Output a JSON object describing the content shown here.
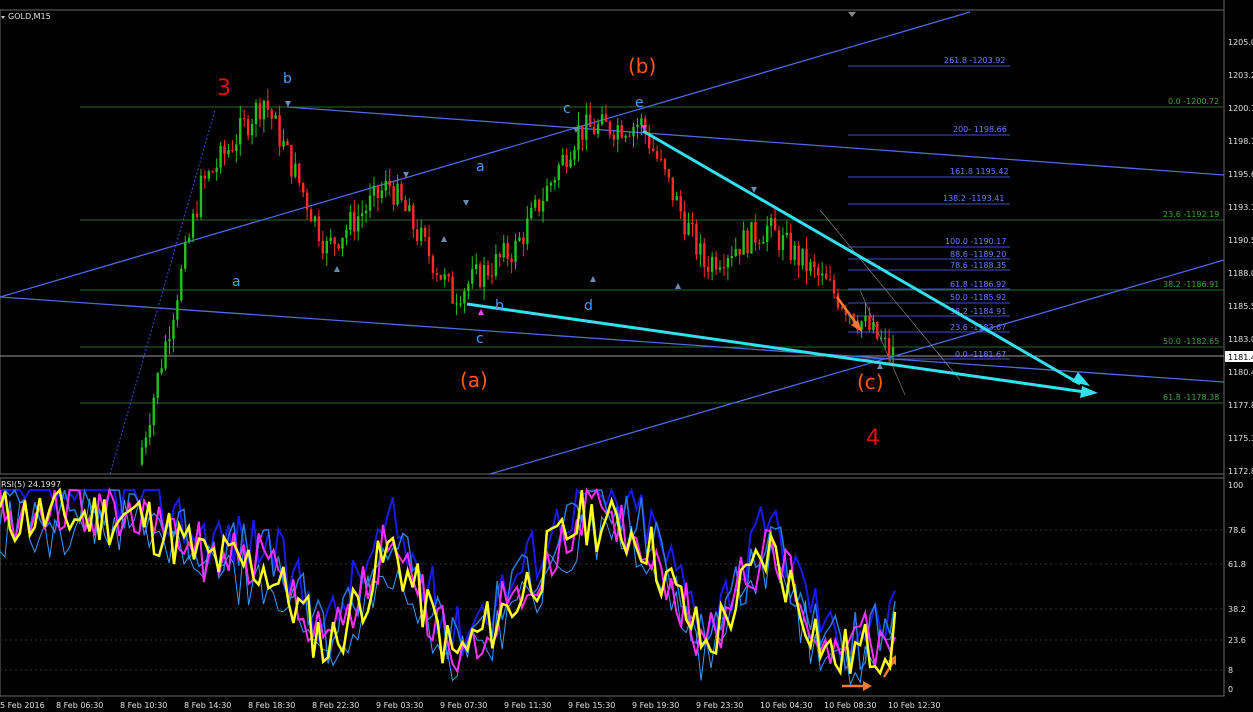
{
  "header": {
    "symbol_label": "GOLD,M15",
    "indicator_label": "RSI(5) 24.1997"
  },
  "price_axis": {
    "ticks": [
      "1205.00",
      "1203.25",
      "1200.70",
      "1198.15",
      "1195.65",
      "1193.10",
      "1190.55",
      "1188.05",
      "1185.50",
      "1183.00",
      "1180.45",
      "1177.85",
      "1175.35",
      "1172.80"
    ],
    "current_price": "1181.4"
  },
  "rsi_axis": {
    "ticks": [
      "100",
      "78.6",
      "61.8",
      "38.2",
      "23.6",
      "8",
      "0"
    ]
  },
  "time_axis": {
    "ticks": [
      "5 Feb 2016",
      "8 Feb 06:30",
      "8 Feb 10:30",
      "8 Feb 14:30",
      "8 Feb 18:30",
      "8 Feb 22:30",
      "9 Feb 03:30",
      "9 Feb 07:30",
      "9 Feb 11:30",
      "9 Feb 15:30",
      "9 Feb 19:30",
      "9 Feb 23:30",
      "10 Feb 04:30",
      "10 Feb 08:30",
      "10 Feb 12:30"
    ]
  },
  "fib_right": [
    "261.8 -1203.92",
    "200- 1198.66",
    "161.8 1195.42",
    "138.2 -1193.41",
    "100.0 -1190.17",
    "88.6 -1189.20",
    "78.6 -1188.35",
    "61.8 -1186.92",
    "50.0 -1185.92",
    "38.2 -1184.91",
    "23.6 -1183.67",
    "0.0 -1181.67"
  ],
  "fib_green": [
    "0.0 -1200.72",
    "23.6 -1192.19",
    "38.2 -1186.91",
    "50.0 -1182.65",
    "61.8 -1178.38"
  ],
  "wave_labels": {
    "red3": "3",
    "red4": "4",
    "b_top": "(b)",
    "a_bot": "(a)",
    "c_bot": "(c)",
    "small_b": "b",
    "small_c": "c",
    "small_e": "e",
    "small_a_mid": "a",
    "small_a_left": "a",
    "small_b_low": "b",
    "small_c_low": "c",
    "small_d": "d"
  },
  "colors": {
    "bull": "#21c21e",
    "bear": "#ff2b2b",
    "blue_line": "#5068e0",
    "cyan_line": "#33e0f0",
    "rsi_yellow": "#ffff20",
    "rsi_magenta": "#ff30ff",
    "rsi_blue": "#1a1af0",
    "label_red": "#e01010",
    "label_orange": "#ff5a10",
    "label_blue": "#4a9aff"
  },
  "chart_data": {
    "type": "line",
    "title": "GOLD,M15",
    "series": [
      {
        "name": "GOLD,M15",
        "x": [
          "8 Feb 10:30",
          "8 Feb 14:30",
          "8 Feb 18:30",
          "8 Feb 22:30",
          "9 Feb 03:30",
          "9 Feb 07:30",
          "9 Feb 11:30",
          "9 Feb 15:30",
          "9 Feb 19:30",
          "9 Feb 23:30",
          "10 Feb 04:30",
          "10 Feb 08:30",
          "10 Feb 12:30"
        ],
        "values": [
          1173.5,
          1194.0,
          1200.5,
          1189.5,
          1194.2,
          1186.0,
          1189.5,
          1198.2,
          1198.7,
          1188.3,
          1191.0,
          1186.5,
          1181.6
        ]
      },
      {
        "name": "RSI(5)",
        "x": [
          "8 Feb 10:30",
          "8 Feb 14:30",
          "8 Feb 18:30",
          "8 Feb 22:30",
          "9 Feb 03:30",
          "9 Feb 07:30",
          "9 Feb 11:30",
          "9 Feb 15:30",
          "9 Feb 19:30",
          "9 Feb 23:30",
          "10 Feb 04:30",
          "10 Feb 08:30",
          "10 Feb 12:30"
        ],
        "values": [
          85,
          65,
          60,
          20,
          70,
          15,
          45,
          85,
          75,
          20,
          70,
          15,
          24.2
        ]
      }
    ],
    "ylim": [
      1172.8,
      1205.9
    ],
    "rsi_ylim": [
      0,
      100
    ]
  }
}
